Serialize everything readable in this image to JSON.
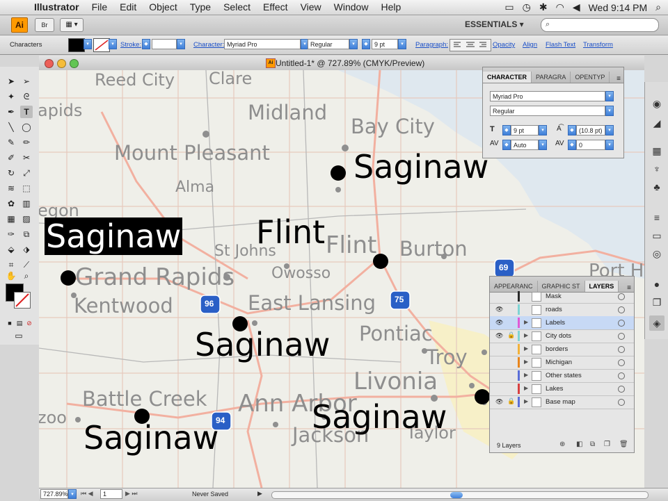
{
  "menubar": {
    "app_name": "Illustrator",
    "items": [
      "File",
      "Edit",
      "Object",
      "Type",
      "Select",
      "Effect",
      "View",
      "Window",
      "Help"
    ],
    "clock": "Wed 9:14 PM"
  },
  "appbar": {
    "logo_text": "Ai",
    "bridge_label": "Br",
    "workspace": "ESSENTIALS ▾",
    "search_glyph": "⌕"
  },
  "control": {
    "context": "Characters",
    "stroke_label": "Stroke:",
    "character_label": "Character:",
    "font_family": "Myriad Pro",
    "font_style": "Regular",
    "font_size": "9 pt",
    "paragraph_label": "Paragraph:",
    "links": [
      "Opacity",
      "Align",
      "Flash Text",
      "Transform"
    ]
  },
  "document": {
    "title": "Untitled-1* @ 727.89% (CMYK/Preview)",
    "title_icon": "Ai"
  },
  "map": {
    "background_labels": [
      {
        "text": "Reed City"
      },
      {
        "text": "Clare"
      },
      {
        "text": "Midland"
      },
      {
        "text": "Bay City"
      },
      {
        "text": "Mount Pleasant"
      },
      {
        "text": "Alma"
      },
      {
        "text": "apids"
      },
      {
        "text": "egon"
      },
      {
        "text": "St Johns"
      },
      {
        "text": "Owosso"
      },
      {
        "text": "Flint"
      },
      {
        "text": "Burton"
      },
      {
        "text": "Grand Rapids"
      },
      {
        "text": "Kentwood"
      },
      {
        "text": "East Lansing"
      },
      {
        "text": "Pontiac"
      },
      {
        "text": "Troy"
      },
      {
        "text": "Livonia"
      },
      {
        "text": "Battle Creek"
      },
      {
        "text": "Ann Arbor"
      },
      {
        "text": "Jackson"
      },
      {
        "text": "Taylor"
      },
      {
        "text": "zoo"
      },
      {
        "text": "Port H"
      }
    ],
    "shields": [
      "69",
      "96",
      "75",
      "94"
    ],
    "city_labels": [
      {
        "text": "Saginaw",
        "selected": false
      },
      {
        "text": "Flint",
        "selected": false
      },
      {
        "text": "Saginaw",
        "selected": true
      },
      {
        "text": "Saginaw",
        "selected": false
      },
      {
        "text": "Saginaw",
        "selected": false
      },
      {
        "text": "Saginaw",
        "selected": false
      }
    ]
  },
  "character_panel": {
    "tabs": [
      "CHARACTER",
      "PARAGRA",
      "OPENTYP"
    ],
    "font_family": "Myriad Pro",
    "font_style": "Regular",
    "size": "9 pt",
    "leading": "(10.8 pt)",
    "kerning": "Auto",
    "tracking": "0"
  },
  "layers_panel": {
    "tabs": [
      "APPEARANC",
      "GRAPHIC ST",
      "LAYERS"
    ],
    "layers": [
      {
        "name": "Mask",
        "color": "#2a2a2a",
        "visible": false,
        "locked": false,
        "expandable": false,
        "active": false
      },
      {
        "name": "roads",
        "color": "#7fd4d4",
        "visible": true,
        "locked": false,
        "expandable": false,
        "active": false
      },
      {
        "name": "Labels",
        "color": "#e05ad6",
        "visible": true,
        "locked": false,
        "expandable": true,
        "active": true
      },
      {
        "name": "City dots",
        "color": "#7fd4d4",
        "visible": true,
        "locked": true,
        "expandable": true,
        "active": false
      },
      {
        "name": "borders",
        "color": "#f2b23a",
        "visible": false,
        "locked": false,
        "expandable": true,
        "active": false
      },
      {
        "name": "Michigan",
        "color": "#e8851c",
        "visible": false,
        "locked": false,
        "expandable": true,
        "active": false
      },
      {
        "name": "Other states",
        "color": "#5a6ed8",
        "visible": false,
        "locked": false,
        "expandable": true,
        "active": false
      },
      {
        "name": "Lakes",
        "color": "#d84040",
        "visible": false,
        "locked": false,
        "expandable": true,
        "active": false
      },
      {
        "name": "Base map",
        "color": "#5a6ed8",
        "visible": true,
        "locked": true,
        "expandable": true,
        "active": false
      }
    ],
    "count": "9 Layers"
  },
  "status": {
    "zoom": "727.89%",
    "artboard": "1",
    "state": "Never Saved"
  },
  "colors": {
    "accent_blue": "#3f7fd9",
    "selection_blue": "#c7d9f5",
    "highway": "#f2b0a0"
  }
}
